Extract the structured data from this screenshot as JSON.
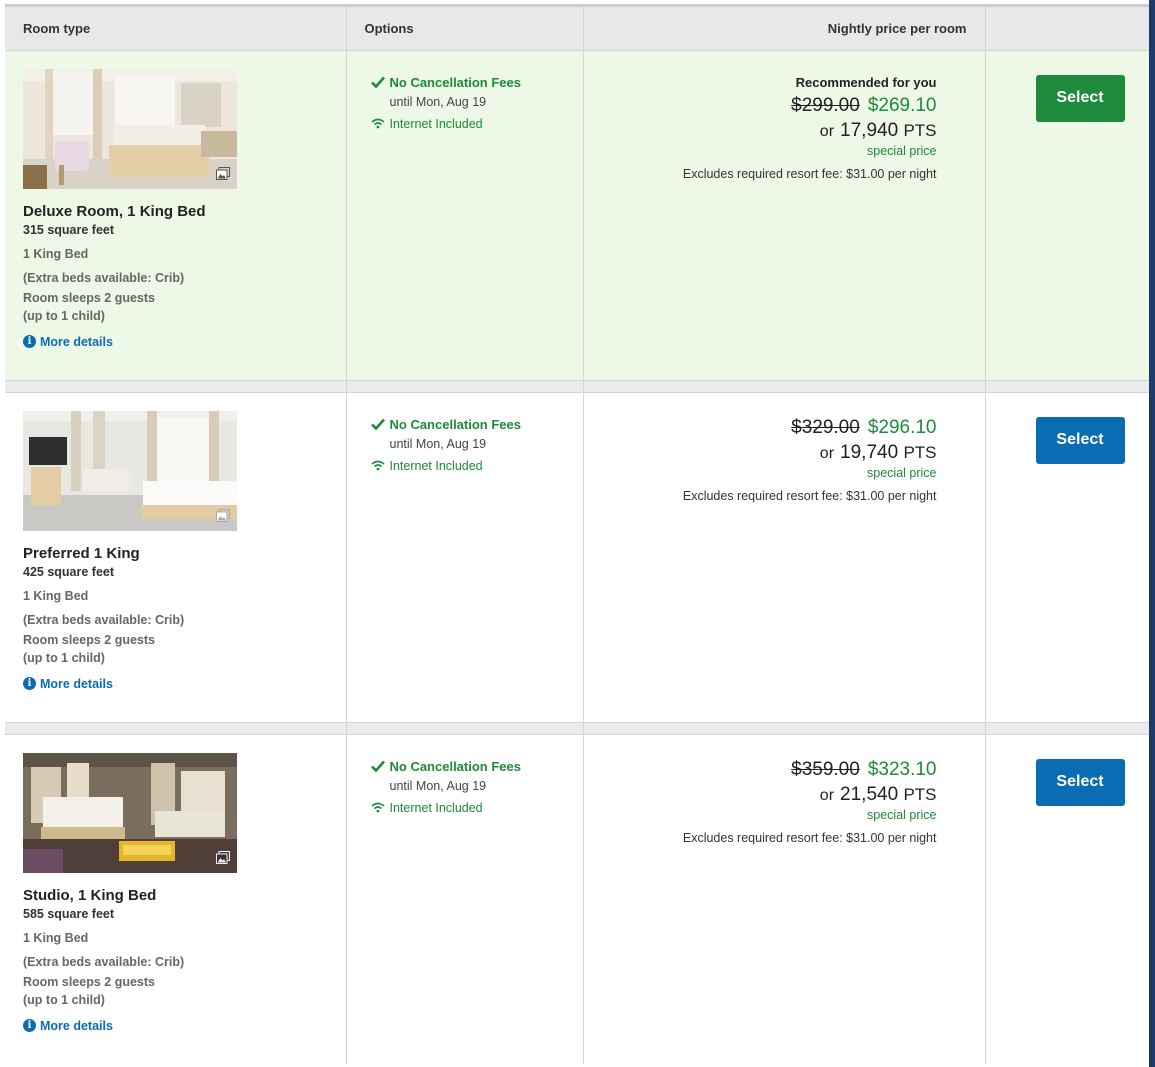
{
  "colors": {
    "green": "#1d8a3c",
    "blue": "#0a6db3",
    "highlight_bg": "#edf8e6",
    "header_bg": "#e8e8e8"
  },
  "header": {
    "room_type": "Room type",
    "options": "Options",
    "nightly_price": "Nightly price per room"
  },
  "rooms": [
    {
      "name": "Deluxe Room, 1 King Bed",
      "sqft": "315 square feet",
      "bed": "1 King Bed",
      "extra_beds": "(Extra beds available: Crib)",
      "sleeps": "Room sleeps 2 guests",
      "children": "(up to 1 child)",
      "more_details": "More details",
      "cancel": "No Cancellation Fees",
      "until": "until Mon, Aug 19",
      "internet": "Internet Included",
      "recommended": "Recommended for you",
      "old_price": "$299.00",
      "new_price": "$269.10",
      "or": "or",
      "points": "17,940",
      "points_unit": "PTS",
      "special": "special price",
      "resort_fee": "Excludes required resort fee: $31.00 per night",
      "select": "Select",
      "gallery_icon": "image-gallery-icon",
      "highlighted": true
    },
    {
      "name": "Preferred 1 King",
      "sqft": "425 square feet",
      "bed": "1 King Bed",
      "extra_beds": "(Extra beds available: Crib)",
      "sleeps": "Room sleeps 2 guests",
      "children": "(up to 1 child)",
      "more_details": "More details",
      "cancel": "No Cancellation Fees",
      "until": "until Mon, Aug 19",
      "internet": "Internet Included",
      "old_price": "$329.00",
      "new_price": "$296.10",
      "or": "or",
      "points": "19,740",
      "points_unit": "PTS",
      "special": "special price",
      "resort_fee": "Excludes required resort fee: $31.00 per night",
      "select": "Select",
      "gallery_icon": "image-gallery-icon",
      "highlighted": false
    },
    {
      "name": "Studio, 1 King Bed",
      "sqft": "585 square feet",
      "bed": "1 King Bed",
      "extra_beds": "(Extra beds available: Crib)",
      "sleeps": "Room sleeps 2 guests",
      "children": "(up to 1 child)",
      "more_details": "More details",
      "cancel": "No Cancellation Fees",
      "until": "until Mon, Aug 19",
      "internet": "Internet Included",
      "old_price": "$359.00",
      "new_price": "$323.10",
      "or": "or",
      "points": "21,540",
      "points_unit": "PTS",
      "special": "special price",
      "resort_fee": "Excludes required resort fee: $31.00 per night",
      "select": "Select",
      "gallery_icon": "image-gallery-icon",
      "highlighted": false
    }
  ]
}
